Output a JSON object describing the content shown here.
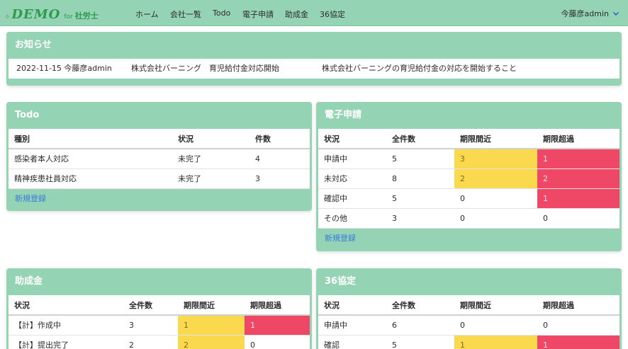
{
  "nav": {
    "logo_main": "DEMO",
    "logo_for": "for",
    "logo_sub": "社労士",
    "items": [
      "ホーム",
      "会社一覧",
      "Todo",
      "電子申請",
      "助成金",
      "36協定"
    ],
    "user": "今藤彦admin"
  },
  "notice": {
    "title": "お知らせ",
    "date_user": "2022-11-15 今藤彦admin",
    "subject": "株式会社バーニング　育児給付金対応開始",
    "body": "株式会社バーニングの育児給付金の対応を開始すること"
  },
  "todo": {
    "title": "Todo",
    "headers": [
      "種別",
      "状況",
      "件数"
    ],
    "rows": [
      {
        "type": "感染者本人対応",
        "status": "未完了",
        "count": "4"
      },
      {
        "type": "精神疾患社員対応",
        "status": "未完了",
        "count": "3"
      }
    ],
    "new_link": "新規登録"
  },
  "efiling": {
    "title": "電子申請",
    "headers": [
      "状況",
      "全件数",
      "期限間近",
      "期限超過"
    ],
    "rows": [
      {
        "status": "申請中",
        "total": "5",
        "near": "3",
        "over": "1"
      },
      {
        "status": "未対応",
        "total": "8",
        "near": "2",
        "over": "2"
      },
      {
        "status": "確認中",
        "total": "5",
        "near": "0",
        "over": "1"
      },
      {
        "status": "その他",
        "total": "3",
        "near": "0",
        "over": "0"
      }
    ],
    "new_link": "新規登録"
  },
  "subsidy": {
    "title": "助成金",
    "headers": [
      "状況",
      "全件数",
      "期限間近",
      "期限超過"
    ],
    "rows": [
      {
        "status": "【計】作成中",
        "total": "3",
        "near": "1",
        "over": "1"
      },
      {
        "status": "【計】提出完了",
        "total": "2",
        "near": "2",
        "over": "0"
      }
    ]
  },
  "agreement36": {
    "title": "36協定",
    "headers": [
      "状況",
      "全件数",
      "期限間近",
      "期限超過"
    ],
    "rows": [
      {
        "status": "申請中",
        "total": "6",
        "near": "0",
        "over": "0"
      },
      {
        "status": "確認",
        "total": "5",
        "near": "1",
        "over": "1"
      }
    ]
  },
  "colors": {
    "nav_bg": "#95d3b5",
    "card_header": "#95d3b5",
    "warn": "#fbd94f",
    "over": "#ef4766",
    "link": "#3c7be0",
    "logo": "#2f9a4b"
  }
}
